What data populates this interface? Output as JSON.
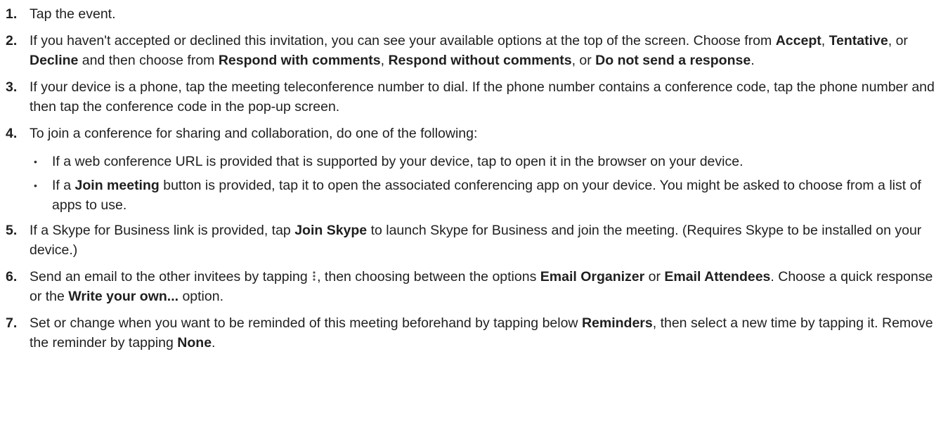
{
  "steps": [
    {
      "num": "1.",
      "parts": [
        {
          "t": "Tap the event."
        }
      ]
    },
    {
      "num": "2.",
      "parts": [
        {
          "t": "If you haven't accepted or declined this invitation, you can see your available options at the top of the screen. Choose from  "
        },
        {
          "t": "Accept",
          "b": true
        },
        {
          "t": ", "
        },
        {
          "t": "Tentative",
          "b": true
        },
        {
          "t": ", or "
        },
        {
          "t": "Decline",
          "b": true
        },
        {
          "t": " and then choose from "
        },
        {
          "t": "Respond with comments",
          "b": true
        },
        {
          "t": ", "
        },
        {
          "t": "Respond without comments",
          "b": true
        },
        {
          "t": ", or "
        },
        {
          "t": "Do not send a response",
          "b": true
        },
        {
          "t": "."
        }
      ]
    },
    {
      "num": "3.",
      "parts": [
        {
          "t": "If your device is a phone, tap the meeting teleconference number to dial. If the phone number contains a conference code, tap the phone number and then tap the conference code in the pop-up screen."
        }
      ]
    },
    {
      "num": "4.",
      "parts": [
        {
          "t": "To join a conference for sharing and collaboration, do one of the following:"
        }
      ],
      "sub": [
        {
          "parts": [
            {
              "t": "If a web conference URL is provided that is supported by your device, tap to open it in the browser on your device."
            }
          ]
        },
        {
          "parts": [
            {
              "t": "If a "
            },
            {
              "t": "Join meeting",
              "b": true
            },
            {
              "t": " button is provided, tap it to open the associated conferencing app on your device. You might be asked to choose from a list of apps to use."
            }
          ]
        }
      ]
    },
    {
      "num": "5.",
      "parts": [
        {
          "t": "If a Skype for Business link is provided, tap "
        },
        {
          "t": "Join Skype",
          "b": true
        },
        {
          "t": " to launch Skype for Business and join the meeting. (Requires Skype to be installed on your device.)"
        }
      ]
    },
    {
      "num": "6.",
      "parts": [
        {
          "t": "Send an email to the other invitees by tapping "
        },
        {
          "icon": "more-vertical-icon"
        },
        {
          "t": ", then choosing between the options "
        },
        {
          "t": "Email Organizer",
          "b": true
        },
        {
          "t": " or "
        },
        {
          "t": "Email Attendees",
          "b": true
        },
        {
          "t": ". Choose a quick response or the "
        },
        {
          "t": "Write your own...",
          "b": true
        },
        {
          "t": " option."
        }
      ]
    },
    {
      "num": "7.",
      "parts": [
        {
          "t": "Set or change when you want to be reminded of this meeting beforehand by tapping below "
        },
        {
          "t": "Reminders",
          "b": true
        },
        {
          "t": ", then select a new time by tapping it. Remove the reminder by tapping "
        },
        {
          "t": "None",
          "b": true
        },
        {
          "t": "."
        }
      ]
    }
  ],
  "bullet_glyph": "•",
  "colors": {
    "text": "#1f1f1f",
    "background": "#ffffff"
  }
}
